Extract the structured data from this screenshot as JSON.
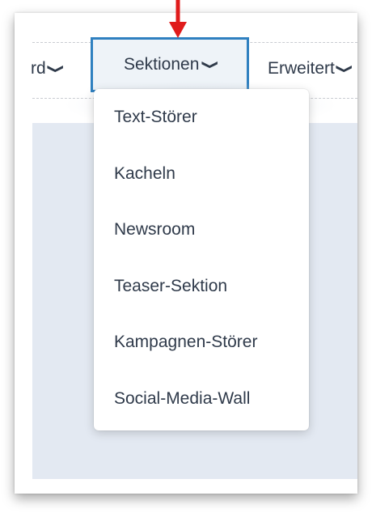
{
  "nav": {
    "left_partial": "rd",
    "active": "Sektionen",
    "right_partial": "Erweitert"
  },
  "dropdown": {
    "items": [
      "Text-Störer",
      "Kacheln",
      "Newsroom",
      "Teaser-Sektion",
      "Kampagnen-Störer",
      "Social-Media-Wall"
    ]
  },
  "colors": {
    "accent_border": "#2f80c0",
    "annotation_arrow": "#e01b1b",
    "content_bg": "#e3e9f2"
  },
  "icons": {
    "chevron": "chevron-down-icon",
    "arrow": "red-arrow-down-icon"
  }
}
